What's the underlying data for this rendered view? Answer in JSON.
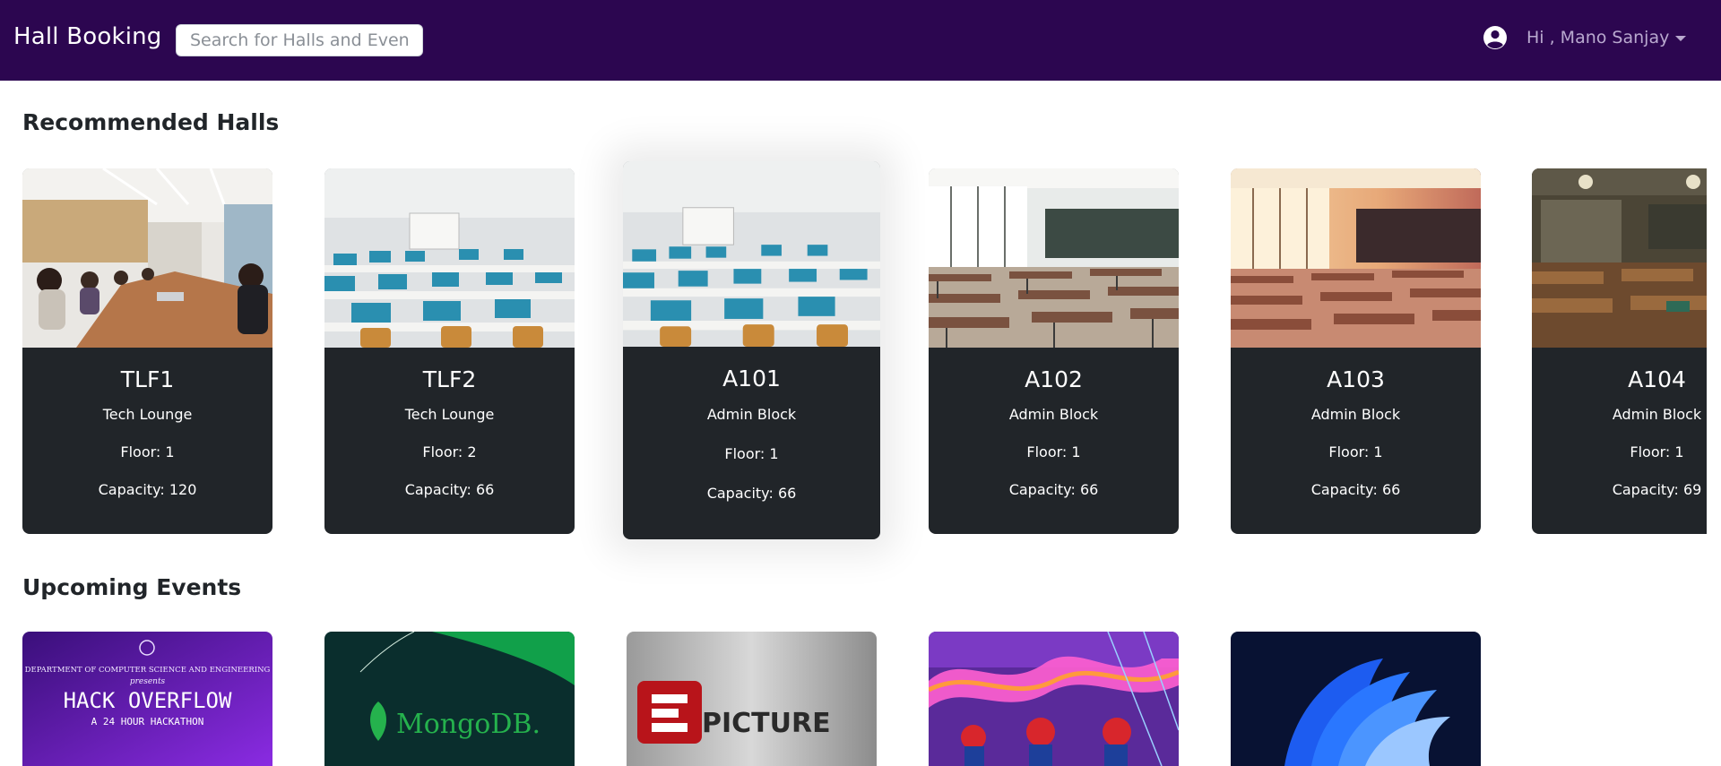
{
  "navbar": {
    "brand": "Hall Booking",
    "search_placeholder": "Search for Halls and Events",
    "greeting": "Hi , Mano Sanjay",
    "user_icon": "user-circle-icon",
    "background": "#2c0650"
  },
  "recommended": {
    "title": "Recommended Halls",
    "halls": [
      {
        "name": "TLF1",
        "block": "Tech Lounge",
        "floor": "Floor: 1",
        "capacity": "Capacity: 120"
      },
      {
        "name": "TLF2",
        "block": "Tech Lounge",
        "floor": "Floor: 2",
        "capacity": "Capacity: 66"
      },
      {
        "name": "A101",
        "block": "Admin Block",
        "floor": "Floor: 1",
        "capacity": "Capacity: 66"
      },
      {
        "name": "A102",
        "block": "Admin Block",
        "floor": "Floor: 1",
        "capacity": "Capacity: 66"
      },
      {
        "name": "A103",
        "block": "Admin Block",
        "floor": "Floor: 1",
        "capacity": "Capacity: 66"
      },
      {
        "name": "A104",
        "block": "Admin Block",
        "floor": "Floor: 1",
        "capacity": "Capacity: 69"
      }
    ]
  },
  "events": {
    "title": "Upcoming Events",
    "items": [
      {
        "dept": "DEPARTMENT OF COMPUTER SCIENCE AND ENGINEERING",
        "presents": "presents",
        "name": "HACK OVERFLOW",
        "subtitle": "A 24 HOUR HACKATHON"
      },
      {
        "name": "MongoDB."
      },
      {
        "name": "PICTURE"
      },
      {
        "name": ""
      },
      {
        "name": ""
      }
    ]
  }
}
